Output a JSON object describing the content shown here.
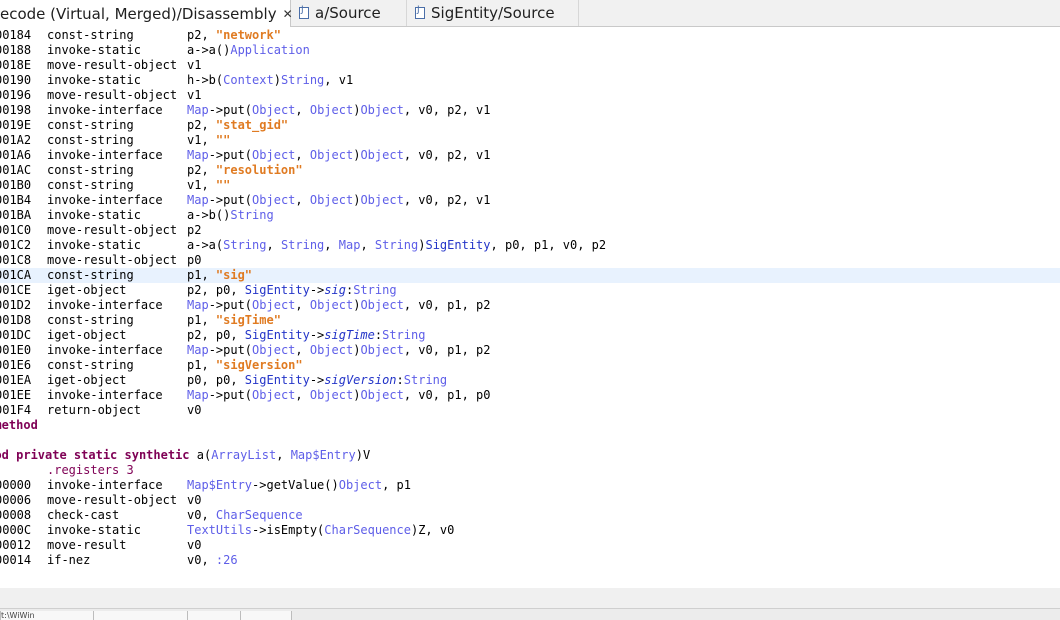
{
  "tabs": [
    {
      "label": "ecode (Virtual, Merged)/Disassembly",
      "close": "✕"
    },
    {
      "label": "a/Source"
    },
    {
      "label": "SigEntity/Source"
    }
  ],
  "code": [
    {
      "addr": "00184",
      "op": "const-string",
      "args": [
        [
          "p2, ",
          ""
        ],
        [
          "\"network\"",
          "s"
        ]
      ]
    },
    {
      "addr": "00188",
      "op": "invoke-static",
      "args": [
        [
          "a->a()",
          ""
        ],
        [
          "Application",
          "t"
        ]
      ]
    },
    {
      "addr": "0018E",
      "op": "move-result-object",
      "args": [
        [
          "v1",
          ""
        ]
      ]
    },
    {
      "addr": "00190",
      "op": "invoke-static",
      "args": [
        [
          "h->b(",
          ""
        ],
        [
          "Context",
          "t"
        ],
        [
          ")",
          ""
        ],
        [
          "String",
          "t"
        ],
        [
          ", v1",
          ""
        ]
      ]
    },
    {
      "addr": "00196",
      "op": "move-result-object",
      "args": [
        [
          "v1",
          ""
        ]
      ]
    },
    {
      "addr": "00198",
      "op": "invoke-interface",
      "args": [
        [
          "Map",
          "t"
        ],
        [
          "->put(",
          ""
        ],
        [
          "Object",
          "t"
        ],
        [
          ", ",
          ""
        ],
        [
          "Object",
          "t"
        ],
        [
          ")",
          ""
        ],
        [
          "Object",
          "t"
        ],
        [
          ", v0, p2, v1",
          ""
        ]
      ]
    },
    {
      "addr": "0019E",
      "op": "const-string",
      "args": [
        [
          "p2, ",
          ""
        ],
        [
          "\"stat_gid\"",
          "s"
        ]
      ]
    },
    {
      "addr": "001A2",
      "op": "const-string",
      "args": [
        [
          "v1, ",
          ""
        ],
        [
          "\"\"",
          "s"
        ]
      ]
    },
    {
      "addr": "001A6",
      "op": "invoke-interface",
      "args": [
        [
          "Map",
          "t"
        ],
        [
          "->put(",
          ""
        ],
        [
          "Object",
          "t"
        ],
        [
          ", ",
          ""
        ],
        [
          "Object",
          "t"
        ],
        [
          ")",
          ""
        ],
        [
          "Object",
          "t"
        ],
        [
          ", v0, p2, v1",
          ""
        ]
      ]
    },
    {
      "addr": "001AC",
      "op": "const-string",
      "args": [
        [
          "p2, ",
          ""
        ],
        [
          "\"resolution\"",
          "s"
        ]
      ]
    },
    {
      "addr": "001B0",
      "op": "const-string",
      "args": [
        [
          "v1, ",
          ""
        ],
        [
          "\"\"",
          "s"
        ]
      ]
    },
    {
      "addr": "001B4",
      "op": "invoke-interface",
      "args": [
        [
          "Map",
          "t"
        ],
        [
          "->put(",
          ""
        ],
        [
          "Object",
          "t"
        ],
        [
          ", ",
          ""
        ],
        [
          "Object",
          "t"
        ],
        [
          ")",
          ""
        ],
        [
          "Object",
          "t"
        ],
        [
          ", v0, p2, v1",
          ""
        ]
      ]
    },
    {
      "addr": "001BA",
      "op": "invoke-static",
      "args": [
        [
          "a->b()",
          ""
        ],
        [
          "String",
          "t"
        ]
      ]
    },
    {
      "addr": "001C0",
      "op": "move-result-object",
      "args": [
        [
          "p2",
          ""
        ]
      ]
    },
    {
      "addr": "001C2",
      "op": "invoke-static",
      "args": [
        [
          "a->a(",
          ""
        ],
        [
          "String",
          "t"
        ],
        [
          ", ",
          ""
        ],
        [
          "String",
          "t"
        ],
        [
          ", ",
          ""
        ],
        [
          "Map",
          "t"
        ],
        [
          ", ",
          ""
        ],
        [
          "String",
          "t"
        ],
        [
          ")",
          ""
        ],
        [
          "SigEntity",
          "b"
        ],
        [
          ", p0, p1, v0, p2",
          ""
        ]
      ]
    },
    {
      "addr": "001C8",
      "op": "move-result-object",
      "args": [
        [
          "p0",
          ""
        ]
      ]
    },
    {
      "addr": "001CA",
      "op": "const-string",
      "args": [
        [
          "p1, ",
          ""
        ],
        [
          "\"sig\"",
          "s"
        ]
      ],
      "highlight": true
    },
    {
      "addr": "001CE",
      "op": "iget-object",
      "args": [
        [
          "p2, p0, ",
          ""
        ],
        [
          "SigEntity",
          "b"
        ],
        [
          "->",
          ""
        ],
        [
          "sig",
          "f"
        ],
        [
          ":",
          ""
        ],
        [
          "String",
          "t"
        ]
      ]
    },
    {
      "addr": "001D2",
      "op": "invoke-interface",
      "args": [
        [
          "Map",
          "t"
        ],
        [
          "->put(",
          ""
        ],
        [
          "Object",
          "t"
        ],
        [
          ", ",
          ""
        ],
        [
          "Object",
          "t"
        ],
        [
          ")",
          ""
        ],
        [
          "Object",
          "t"
        ],
        [
          ", v0, p1, p2",
          ""
        ]
      ]
    },
    {
      "addr": "001D8",
      "op": "const-string",
      "args": [
        [
          "p1, ",
          ""
        ],
        [
          "\"sigTime\"",
          "s"
        ]
      ]
    },
    {
      "addr": "001DC",
      "op": "iget-object",
      "args": [
        [
          "p2, p0, ",
          ""
        ],
        [
          "SigEntity",
          "b"
        ],
        [
          "->",
          ""
        ],
        [
          "sigTime",
          "f"
        ],
        [
          ":",
          ""
        ],
        [
          "String",
          "t"
        ]
      ]
    },
    {
      "addr": "001E0",
      "op": "invoke-interface",
      "args": [
        [
          "Map",
          "t"
        ],
        [
          "->put(",
          ""
        ],
        [
          "Object",
          "t"
        ],
        [
          ", ",
          ""
        ],
        [
          "Object",
          "t"
        ],
        [
          ")",
          ""
        ],
        [
          "Object",
          "t"
        ],
        [
          ", v0, p1, p2",
          ""
        ]
      ]
    },
    {
      "addr": "001E6",
      "op": "const-string",
      "args": [
        [
          "p1, ",
          ""
        ],
        [
          "\"sigVersion\"",
          "s"
        ]
      ]
    },
    {
      "addr": "001EA",
      "op": "iget-object",
      "args": [
        [
          "p0, p0, ",
          ""
        ],
        [
          "SigEntity",
          "b"
        ],
        [
          "->",
          ""
        ],
        [
          "sigVersion",
          "f"
        ],
        [
          ":",
          ""
        ],
        [
          "String",
          "t"
        ]
      ]
    },
    {
      "addr": "001EE",
      "op": "invoke-interface",
      "args": [
        [
          "Map",
          "t"
        ],
        [
          "->put(",
          ""
        ],
        [
          "Object",
          "t"
        ],
        [
          ", ",
          ""
        ],
        [
          "Object",
          "t"
        ],
        [
          ")",
          ""
        ],
        [
          "Object",
          "t"
        ],
        [
          ", v0, p1, p0",
          ""
        ]
      ]
    },
    {
      "addr": "001F4",
      "op": "return-object",
      "args": [
        [
          "v0",
          ""
        ]
      ]
    },
    {
      "full": [
        [
          "d method",
          "kw"
        ]
      ]
    },
    {
      "blank": true
    },
    {
      "full": [
        [
          "thod private static synthetic ",
          "kw"
        ],
        [
          "a(",
          ""
        ],
        [
          "ArrayList",
          "t"
        ],
        [
          ", ",
          ""
        ],
        [
          "Map$Entry",
          "t"
        ],
        [
          ")V",
          ""
        ]
      ]
    },
    {
      "directive": ".registers 3"
    },
    {
      "addr": "00000",
      "op": "invoke-interface",
      "args": [
        [
          "Map$Entry",
          "t"
        ],
        [
          "->getValue()",
          ""
        ],
        [
          "Object",
          "t"
        ],
        [
          ", p1",
          ""
        ]
      ]
    },
    {
      "addr": "00006",
      "op": "move-result-object",
      "args": [
        [
          "v0",
          ""
        ]
      ]
    },
    {
      "addr": "00008",
      "op": "check-cast",
      "args": [
        [
          "v0, ",
          ""
        ],
        [
          "CharSequence",
          "t"
        ]
      ]
    },
    {
      "addr": "0000C",
      "op": "invoke-static",
      "args": [
        [
          "TextUtils",
          "t"
        ],
        [
          "->isEmpty(",
          ""
        ],
        [
          "CharSequence",
          "t"
        ],
        [
          ")Z, v0",
          ""
        ]
      ]
    },
    {
      "addr": "00012",
      "op": "move-result",
      "args": [
        [
          "v0",
          ""
        ]
      ]
    },
    {
      "addr": "00014",
      "op": "if-nez",
      "args": [
        [
          "v0, ",
          ""
        ],
        [
          ":26",
          "t"
        ]
      ]
    }
  ],
  "bottom_tabs": [
    "t:\\WiWin",
    "",
    "",
    ""
  ]
}
